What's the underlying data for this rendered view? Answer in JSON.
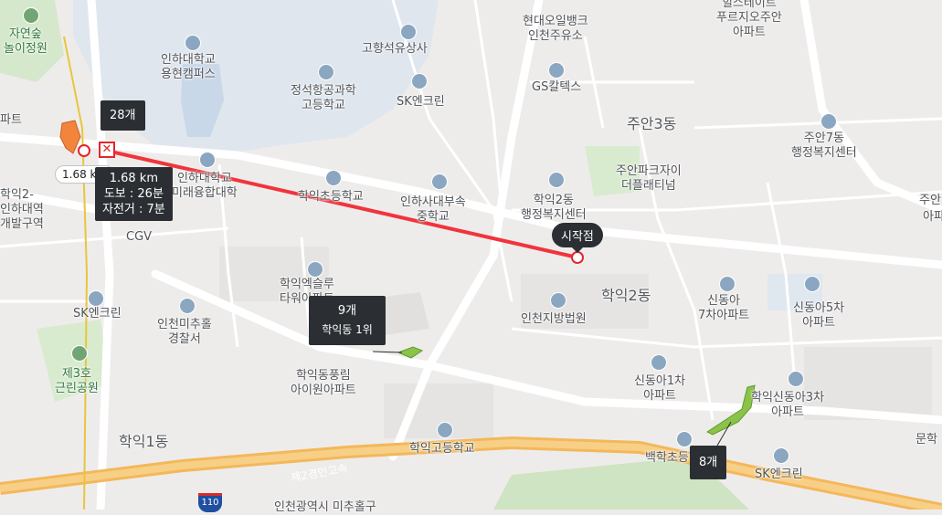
{
  "labels": {
    "nature_park": "자연숲\n놀이정원",
    "inha_univ": "인하대학교\n용현캠퍼스",
    "gohyang": "고향석유상사",
    "hyundai_oil": "현대오일뱅크\n인천주유소",
    "hillstate": "힐스테이트\n푸르지오주안\n아파트",
    "jeongseok": "정석항공과학\n고등학교",
    "sk_en_top": "SK엔크린",
    "gs_caltex": "GS칼텍스",
    "juan3": "주안3동",
    "juan7": "주안7동\n행정복지센터",
    "inha_future": "인하대학교\n미래융합대학",
    "hakik_elem": "학익초등학교",
    "inha_sabu": "인하사대부속\n중학교",
    "hakik2_center": "학익2동\n행정복지센터",
    "juan_park_xi": "주안파크자이\n더플래티넘",
    "hakik2_dev": "학익2-\n인하대역\n개발구역",
    "cgv": "CGV",
    "sk_en_left": "SK엔크린",
    "hakik_exc": "학익엑슬루\n타워아파트",
    "incheon_court": "인천지방법원",
    "hakik2": "학익2동",
    "sindonga7": "신동아\n7차아파트",
    "sindonga5": "신동아5차\n아파트",
    "michuhol_police": "인천미추홀\n경찰서",
    "park3": "제3호\n근린공원",
    "hakik_pungrim": "학익동풍림\n아이원아파트",
    "sindonga1": "신동아1차\n아파트",
    "hakik_sindonga3": "학익신동아3차\n아파트",
    "hakik1": "학익1동",
    "hakik_high": "학익고등학교",
    "baekhak": "백학초등학교",
    "sk_en_bottom": "SK엔크린",
    "highway": "제2경인고속",
    "left_partial": "파트",
    "inha_station": "인하대역",
    "right_partial_1": "주안",
    "right_partial_2": "아파",
    "right_partial_3": "문학",
    "bottom_partial": "인천광역시 미추홀구"
  },
  "route": {
    "start_label": "시작점",
    "distance_tag": "1.68 km",
    "info_distance": "1.68 km",
    "info_walk": "도보 : 26분",
    "info_bike": "자전거 : 7분",
    "end_icon": "close-icon"
  },
  "clusters": {
    "c1_count": "28개",
    "c2_count": "9개",
    "c2_sub": "학익동 1위",
    "c3_count": "8개"
  },
  "highway_shield": "110",
  "colors": {
    "route_line": "#f1343c",
    "highlight_polygon": "#8bc34a",
    "water": "#dfe7ef",
    "park": "#cfe6c4",
    "road_major": "#ffffff",
    "highway": "#f6c36b",
    "marker_dark": "#2b2f33"
  }
}
